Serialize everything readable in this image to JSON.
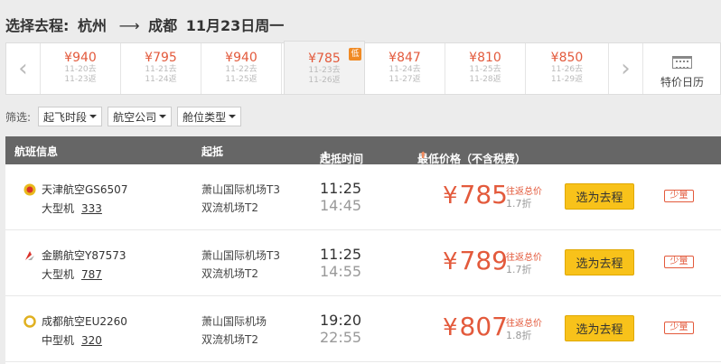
{
  "header": {
    "prefix": "选择去程:",
    "from": "杭州",
    "arrow": "⟶",
    "to": "成都",
    "date": "11月23日周一"
  },
  "date_strip": {
    "prev_icon": "chevron-left-icon",
    "next_icon": "chevron-right-icon",
    "cells": [
      {
        "price": "¥940",
        "go": "11-20去",
        "ret": "11-23返"
      },
      {
        "price": "¥795",
        "go": "11-21去",
        "ret": "11-24返"
      },
      {
        "price": "¥940",
        "go": "11-22去",
        "ret": "11-25返"
      },
      {
        "price": "¥785",
        "go": "11-23去",
        "ret": "11-26返",
        "badge": "低"
      },
      {
        "price": "¥847",
        "go": "11-24去",
        "ret": "11-27返"
      },
      {
        "price": "¥810",
        "go": "11-25去",
        "ret": "11-28返"
      },
      {
        "price": "¥850",
        "go": "11-26去",
        "ret": "11-29返"
      }
    ],
    "active_index": 3,
    "calendar_label": "特价日历"
  },
  "filters": {
    "label": "筛选:",
    "items": [
      "起飞时段",
      "航空公司",
      "舱位类型"
    ]
  },
  "table_header": {
    "flight": "航班信息",
    "route": "起抵",
    "time": "起抵时间",
    "time_sort": "⬇",
    "price": "最低价格（不含税费）",
    "price_sort": "⬆"
  },
  "flights": [
    {
      "airline": "天津航空GS6507",
      "aircraft_type": "大型机",
      "model": "333",
      "dep_airport": "萧山国际机场T3",
      "arr_airport": "双流机场T2",
      "dep_time": "11:25",
      "arr_time": "14:45",
      "yen": "¥",
      "price": "785",
      "roundtrip_label": "往返总价",
      "discount": "1.7折",
      "select_label": "选为去程",
      "few_label": "少量",
      "logo_color": "#e8b91c"
    },
    {
      "airline": "金鹏航空Y87573",
      "aircraft_type": "大型机",
      "model": "787",
      "dep_airport": "萧山国际机场T3",
      "arr_airport": "双流机场T2",
      "dep_time": "11:25",
      "arr_time": "14:55",
      "yen": "¥",
      "price": "789",
      "roundtrip_label": "往返总价",
      "discount": "1.7折",
      "select_label": "选为去程",
      "few_label": "少量",
      "logo_color": "#d9322b"
    },
    {
      "airline": "成都航空EU2260",
      "aircraft_type": "中型机",
      "model": "320",
      "dep_airport": "萧山国际机场",
      "arr_airport": "双流机场T2",
      "dep_time": "19:20",
      "arr_time": "22:55",
      "yen": "¥",
      "price": "807",
      "roundtrip_label": "往返总价",
      "discount": "1.8折",
      "select_label": "选为去程",
      "few_label": "少量",
      "logo_color": "#e0b020"
    }
  ],
  "colors": {
    "accent_price": "#e35a3c",
    "select_button": "#f8c21a",
    "table_header_bg": "#666666"
  }
}
